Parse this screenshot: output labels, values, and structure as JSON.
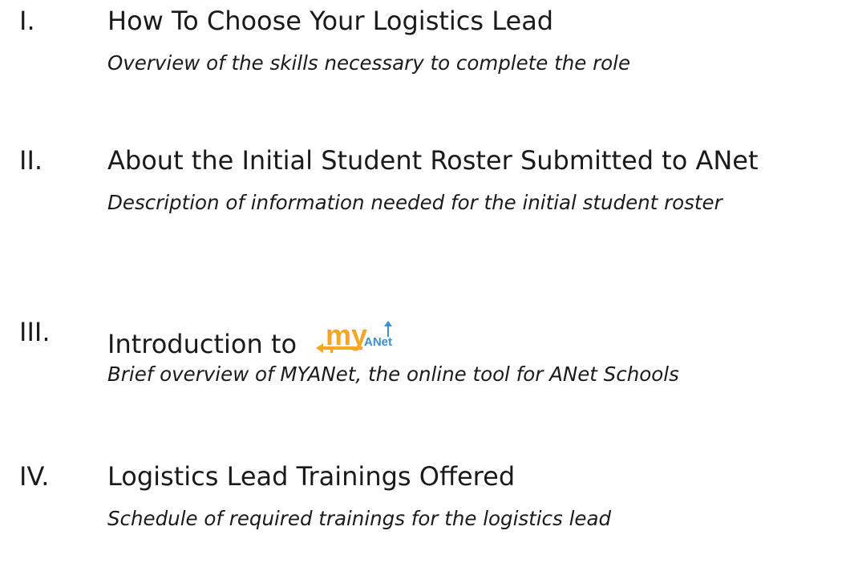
{
  "outline": {
    "items": [
      {
        "numeral": "I.",
        "heading": "How To Choose Your Logistics Lead",
        "subtitle": "Overview of the skills necessary to complete the role"
      },
      {
        "numeral": "II.",
        "heading": "About the Initial Student Roster Submitted to ANet",
        "subtitle": "Description of information needed for the initial student roster"
      },
      {
        "numeral": "III.",
        "heading": "Introduction to",
        "logo": {
          "text_my": "my",
          "text_anet": "ANet",
          "color_orange": "#f5a623",
          "color_blue": "#3b8ed4"
        },
        "subtitle": "Brief overview of MYANet, the online tool for ANet Schools"
      },
      {
        "numeral": "IV.",
        "heading": "Logistics Lead Trainings Offered",
        "subtitle": "Schedule of required trainings for the logistics lead"
      }
    ]
  }
}
